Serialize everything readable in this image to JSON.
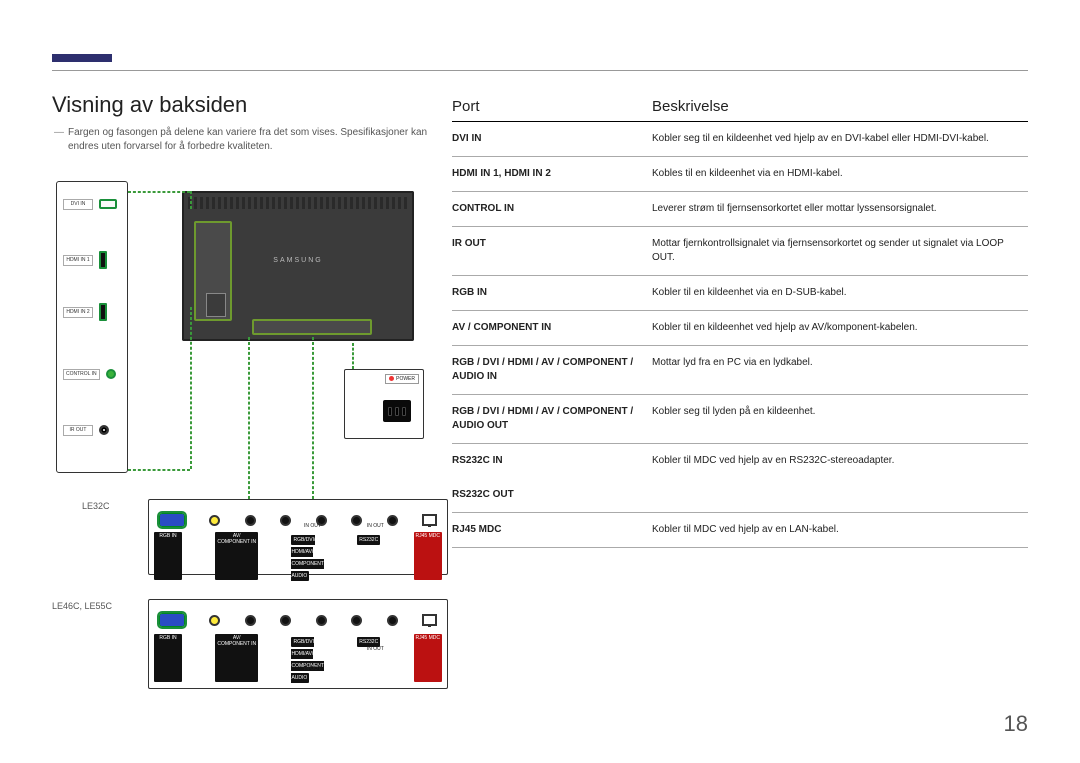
{
  "heading": "Visning av baksiden",
  "note": "Fargen og fasongen på delene kan variere fra det som vises. Spesifikasjoner kan endres uten forvarsel for å forbedre kvaliteten.",
  "monitor_brand": "SAMSUNG",
  "power_label": "POWER",
  "side_ports": {
    "dvi": "DVI IN",
    "hdmi1": "HDMI IN 1",
    "hdmi2": "HDMI IN 2",
    "control": "CONTROL IN",
    "irout": "IR OUT"
  },
  "model_label_1": "LE32C",
  "model_label_2": "LE46C, LE55C",
  "panel1_labels": {
    "rgb": "RGB IN",
    "avcomp": "AV/\nCOMPONENT IN",
    "audio_top": "IN      OUT",
    "audio": "RGB/DVI/\nHDMI/AV/\nCOMPONENT\nAUDIO",
    "rs232_top": "IN      OUT",
    "rs232": "RS232C",
    "rj45": "RJ45 MDC"
  },
  "panel2_labels": {
    "rgb": "RGB IN",
    "avcomp": "AV/\nCOMPONENT IN",
    "audio": "RGB/DVI\nHDMI/AV/\nCOMPONENT\nAUDIO",
    "audio_sub": "IN      OUT",
    "rs232": "RS232C",
    "rs232_sub": "IN      OUT",
    "rj45": "RJ45 MDC"
  },
  "table_headers": {
    "port": "Port",
    "desc": "Beskrivelse"
  },
  "rows": [
    {
      "port": "DVI IN",
      "desc": "Kobler seg til en kildeenhet ved hjelp av en DVI-kabel eller HDMI-DVI-kabel."
    },
    {
      "port": "HDMI IN 1, HDMI IN 2",
      "desc": "Kobles til en kildeenhet via en HDMI-kabel."
    },
    {
      "port": "CONTROL IN",
      "desc": "Leverer strøm til fjernsensorkortet eller mottar lyssensorsignalet."
    },
    {
      "port": "IR OUT",
      "desc": "Mottar fjernkontrollsignalet via fjernsensorkortet og sender ut signalet via LOOP OUT."
    },
    {
      "port": "RGB IN",
      "desc": "Kobler til en kildeenhet via en D-SUB-kabel."
    },
    {
      "port": "AV / COMPONENT IN",
      "desc": "Kobler til en kildeenhet ved hjelp av AV/komponent-kabelen."
    },
    {
      "port": "RGB / DVI / HDMI / AV / COMPONENT / AUDIO IN",
      "desc": "Mottar lyd fra en PC via en lydkabel."
    },
    {
      "port": "RGB / DVI / HDMI / AV / COMPONENT / AUDIO OUT",
      "desc": "Kobler seg til lyden på en kildeenhet."
    },
    {
      "port": "RS232C IN",
      "desc": "Kobler til MDC ved hjelp av en RS232C-stereoadapter."
    },
    {
      "port": "RS232C OUT",
      "desc": ""
    },
    {
      "port": "RJ45 MDC",
      "desc": "Kobler til MDC ved hjelp av en LAN-kabel."
    }
  ],
  "page_number": "18"
}
